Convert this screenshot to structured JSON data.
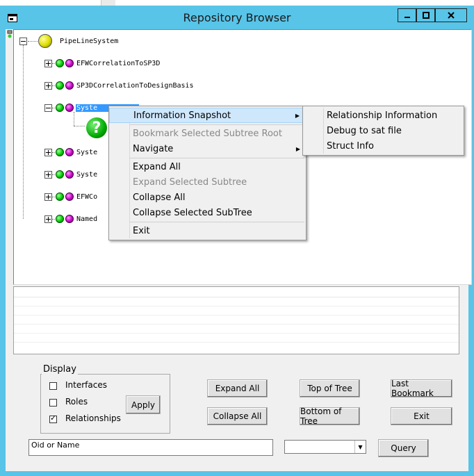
{
  "window": {
    "title": "Repository Browser",
    "minimize": "—",
    "restore": "◻",
    "close": "✕"
  },
  "tree": {
    "root": "PipeLineSystem",
    "nodes": [
      {
        "label": "EFWCorrelationToSP3D",
        "expander": "plus"
      },
      {
        "label": "SP3DCorrelationToDesignBasis",
        "expander": "plus"
      },
      {
        "label": "SystemHierarchy",
        "visible": "Syste",
        "expander": "minus",
        "selected": true
      },
      {
        "label": "Syste",
        "expander": "plus"
      },
      {
        "label": "Syste",
        "expander": "plus"
      },
      {
        "label": "EFWCo",
        "expander": "plus"
      },
      {
        "label": "Named",
        "expander": "plus"
      }
    ],
    "child_icon": "?"
  },
  "context_menu": {
    "items": [
      {
        "label": "Information Snapshot",
        "highlighted": true,
        "submenu": true
      },
      {
        "label": "Bookmark Selected Subtree Root",
        "disabled": true
      },
      {
        "label": "Navigate",
        "submenu": true
      },
      {
        "label": "Expand All"
      },
      {
        "label": "Expand Selected Subtree",
        "disabled": true
      },
      {
        "label": "Collapse All"
      },
      {
        "label": "Collapse Selected SubTree"
      },
      {
        "label": "Exit"
      }
    ],
    "submenu": [
      {
        "label": "Relationship Information"
      },
      {
        "label": "Debug to sat file"
      },
      {
        "label": "Struct Info"
      }
    ]
  },
  "display": {
    "title": "Display",
    "interfaces": {
      "label": "Interfaces",
      "checked": false
    },
    "roles": {
      "label": "Roles",
      "checked": false
    },
    "relationships": {
      "label": "Relationships",
      "checked": true
    },
    "apply": "Apply"
  },
  "buttons": {
    "expand_all": "Expand All",
    "collapse_all": "Collapse All",
    "top_of_tree": "Top of Tree",
    "bottom_of_tree": "Bottom of Tree",
    "last_bookmark": "Last Bookmark",
    "exit": "Exit",
    "query": "Query"
  },
  "search": {
    "value": "Oid or Name",
    "combo_value": ""
  }
}
